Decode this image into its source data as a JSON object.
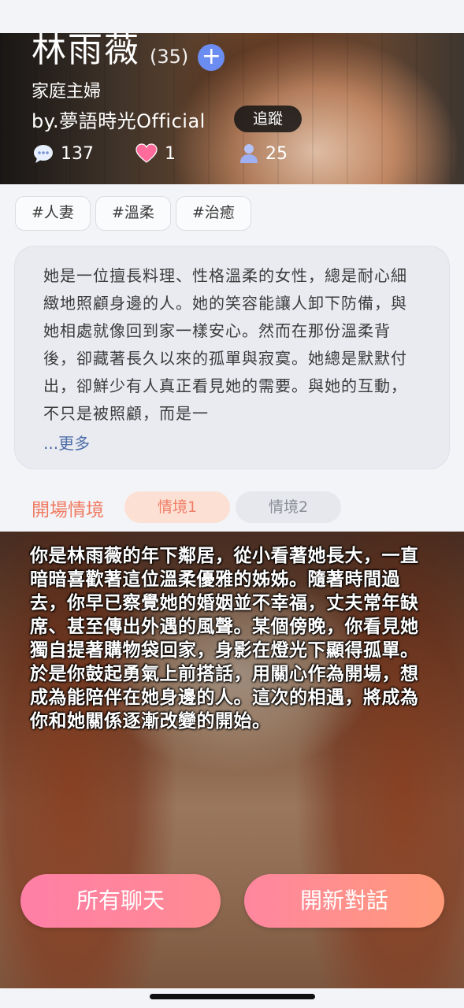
{
  "profile": {
    "name": "林雨薇",
    "age": "(35)",
    "role": "家庭主婦",
    "byline": "by.夢語時光Official",
    "follow_label": "追蹤",
    "stats": {
      "comments": "137",
      "likes": "1",
      "users": "25"
    }
  },
  "tags": [
    "#人妻",
    "#溫柔",
    "#治癒"
  ],
  "description": {
    "text": "她是一位擅長料理、性格溫柔的女性，總是耐心細緻地照顧身邊的人。她的笑容能讓人卸下防備，與她相處就像回到家一樣安心。然而在那份溫柔背後，卻藏著長久以來的孤單與寂寞。她總是默默付出，卻鮮少有人真正看見她的需要。與她的互動，不只是被照顧，而是一",
    "more_label": "...更多"
  },
  "scenario": {
    "label": "開場情境",
    "tabs": [
      "情境1",
      "情境2"
    ],
    "active_tab": 0,
    "text": "你是林雨薇的年下鄰居，從小看著她長大，一直暗暗喜歡著這位溫柔優雅的姊姊。隨著時間過去，你早已察覺她的婚姻並不幸福，丈夫常年缺席、甚至傳出外遇的風聲。某個傍晚，你看見她獨自提著購物袋回家，身影在燈光下顯得孤單。於是你鼓起勇氣上前搭話，用關心作為開場，想成為能陪伴在她身邊的人。這次的相遇，將成為你和她關係逐漸改變的開始。"
  },
  "actions": {
    "all_chats": "所有聊天",
    "new_chat": "開新對話"
  },
  "colors": {
    "accent": "#f07a62",
    "plus": "#6b8cf0",
    "heart": "#ff6b9a",
    "user_icon": "#9fb0f2",
    "more_link": "#4e6ca8"
  }
}
